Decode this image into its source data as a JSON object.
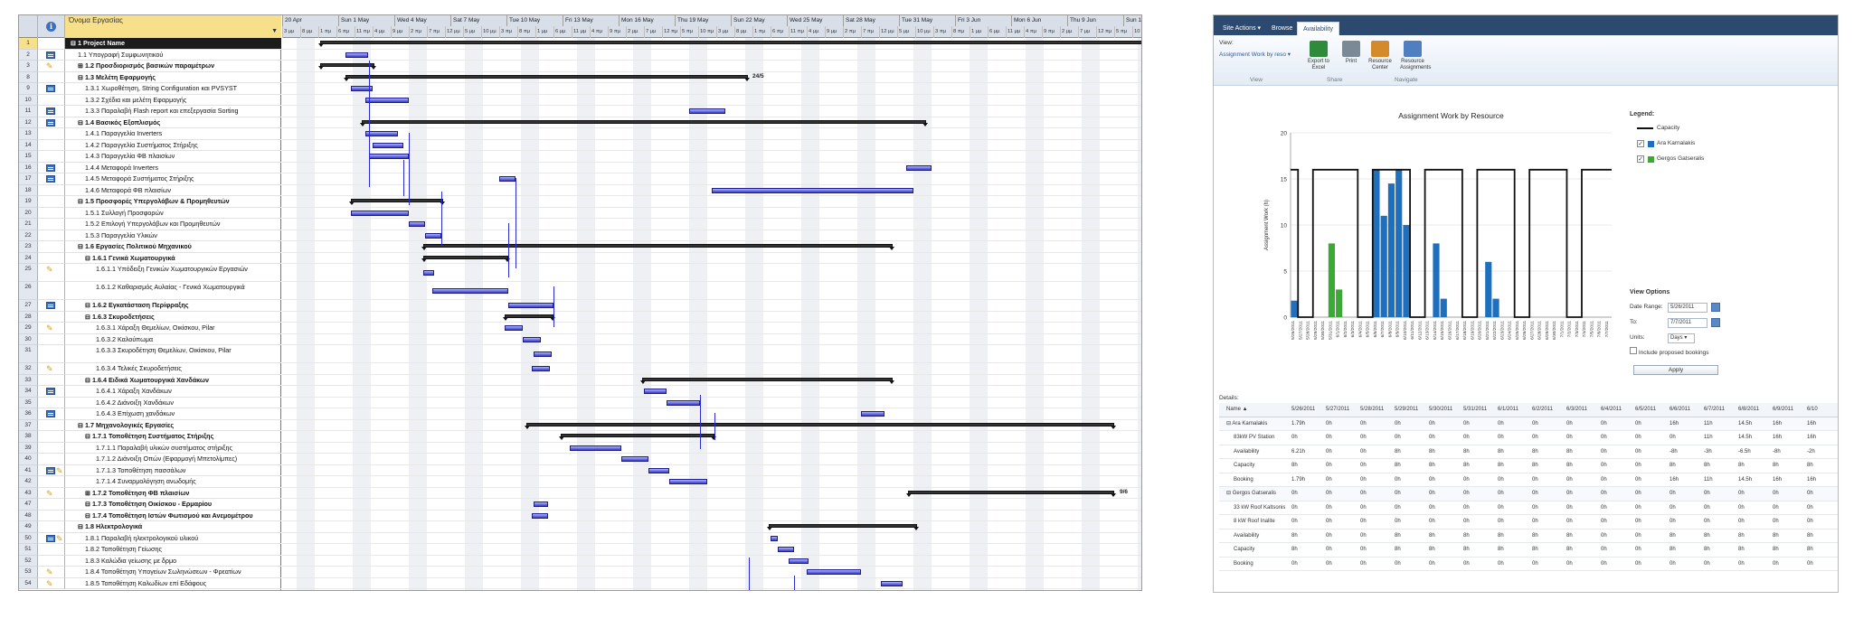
{
  "gantt": {
    "header": {
      "name_col": "Όνομα Εργασίας"
    },
    "weeks": [
      "20 Apr",
      "Sun 1 May",
      "Wed 4 May",
      "Sat 7 May",
      "Tue 10 May",
      "Fri 13 May",
      "Mon 16 May",
      "Thu 19 May",
      "Sun 22 May",
      "Wed 25 May",
      "Sat 28 May",
      "Tue 31 May",
      "Fri 3 Jun",
      "Mon 6 Jun",
      "Thu 9 Jun",
      "Sun 12"
    ],
    "periods": [
      "3 μμ",
      "8 μμ",
      "1 πμ",
      "6 πμ",
      "11 πμ",
      "4 μμ",
      "9 μμ",
      "2 πμ",
      "7 πμ",
      "12 μμ",
      "5 μμ",
      "10 μμ",
      "3 πμ",
      "8 πμ",
      "1 μμ",
      "6 μμ",
      "11 μμ",
      "4 πμ",
      "9 πμ",
      "2 μμ",
      "7 μμ",
      "12 πμ",
      "5 πμ",
      "10 πμ",
      "3 μμ",
      "8 μμ",
      "1 πμ",
      "6 πμ",
      "11 πμ",
      "4 μμ",
      "9 μμ",
      "2 πμ",
      "7 πμ",
      "12 μμ",
      "5 μμ",
      "10 μμ",
      "3 πμ",
      "8 πμ",
      "1 μμ",
      "6 μμ",
      "11 μμ",
      "4 πμ",
      "9 πμ",
      "2 μμ",
      "7 μμ",
      "12 πμ",
      "5 πμ",
      "10 πμ",
      "3 μμ",
      "8 μμ"
    ],
    "rows": [
      {
        "num": "1",
        "name": "1 Project Name",
        "level": 0,
        "type": "sel",
        "ind": ""
      },
      {
        "num": "2",
        "name": "1.1 Υπογραφή Συμφωνητικού",
        "level": 1,
        "type": "task",
        "ind": "note"
      },
      {
        "num": "3",
        "name": "1.2 Προσδιορισμός βασικών παραμέτρων",
        "level": 1,
        "type": "sum",
        "ind": "flag",
        "collapsed": true
      },
      {
        "num": "8",
        "name": "1.3 Μελέτη Εφαρμογής",
        "level": 1,
        "type": "sum",
        "ind": ""
      },
      {
        "num": "9",
        "name": "1.3.1 Χωροθέτηση, String Configuration και PVSYST",
        "level": 2,
        "type": "task",
        "ind": "note"
      },
      {
        "num": "10",
        "name": "1.3.2 Σχέδια και μελέτη Εφαρμογής",
        "level": 2,
        "type": "task",
        "ind": ""
      },
      {
        "num": "11",
        "name": "1.3.3 Παραλαβή Flash report και επεξεργασία Sorting",
        "level": 2,
        "type": "task",
        "ind": "note"
      },
      {
        "num": "12",
        "name": "1.4 Βασικός Εξοπλισμός",
        "level": 1,
        "type": "sum",
        "ind": "note"
      },
      {
        "num": "13",
        "name": "1.4.1 Παραγγελία Inverters",
        "level": 2,
        "type": "task",
        "ind": ""
      },
      {
        "num": "14",
        "name": "1.4.2 Παραγγελία Συστήματος Στήριξης",
        "level": 2,
        "type": "task",
        "ind": ""
      },
      {
        "num": "15",
        "name": "1.4.3 Παραγγελία ΦΒ πλαισίων",
        "level": 2,
        "type": "task",
        "ind": ""
      },
      {
        "num": "16",
        "name": "1.4.4 Μεταφορά Inverters",
        "level": 2,
        "type": "task",
        "ind": "note"
      },
      {
        "num": "17",
        "name": "1.4.5 Μεταφορά Συστήματος Στήριξης",
        "level": 2,
        "type": "task",
        "ind": "note"
      },
      {
        "num": "18",
        "name": "1.4.6 Μεταφορά ΦΒ πλαισίων",
        "level": 2,
        "type": "task",
        "ind": ""
      },
      {
        "num": "19",
        "name": "1.5 Προσφορές Υπεργολάβων & Προμηθευτών",
        "level": 1,
        "type": "sum",
        "ind": ""
      },
      {
        "num": "20",
        "name": "1.5.1 Συλλογή Προσφορών",
        "level": 2,
        "type": "task",
        "ind": ""
      },
      {
        "num": "21",
        "name": "1.5.2 Επιλογή Υπεργολάβων και Προμηθευτών",
        "level": 2,
        "type": "task",
        "ind": ""
      },
      {
        "num": "22",
        "name": "1.5.3 Παραγγελία Υλικών",
        "level": 2,
        "type": "task",
        "ind": ""
      },
      {
        "num": "23",
        "name": "1.6 Εργασίες Πολιτικού Μηχανικού",
        "level": 1,
        "type": "sum",
        "ind": ""
      },
      {
        "num": "24",
        "name": "1.6.1 Γενικά Χωματουργικά",
        "level": 2,
        "type": "sum",
        "ind": ""
      },
      {
        "num": "25",
        "name": "1.6.1.1 Υπόδειξη Γενικών Χωματουργικών Εργασιών",
        "level": 3,
        "type": "task",
        "ind": "flag",
        "tall": true
      },
      {
        "num": "26",
        "name": "1.6.1.2 Καθαρισμός Αυλαίας - Γενικά Χωματουργικά",
        "level": 3,
        "type": "task",
        "ind": "",
        "tall": true
      },
      {
        "num": "27",
        "name": "1.6.2 Εγκατάσταση Περίφραξης",
        "level": 2,
        "type": "sum",
        "ind": "note"
      },
      {
        "num": "28",
        "name": "1.6.3 Σκυροδετήσεις",
        "level": 2,
        "type": "sum",
        "ind": ""
      },
      {
        "num": "29",
        "name": "1.6.3.1 Χάραξη Θεμελίων, Οικίσκου, Pilar",
        "level": 3,
        "type": "task",
        "ind": "flag"
      },
      {
        "num": "30",
        "name": "1.6.3.2 Καλούπωμα",
        "level": 3,
        "type": "task",
        "ind": ""
      },
      {
        "num": "31",
        "name": "1.6.3.3 Σκυροδέτηση Θεμελίων, Οικίσκου, Pilar",
        "level": 3,
        "type": "task",
        "ind": "",
        "tall": true
      },
      {
        "num": "32",
        "name": "1.6.3.4 Τελικές Σκυροδετήσεις",
        "level": 3,
        "type": "task",
        "ind": "flag"
      },
      {
        "num": "33",
        "name": "1.6.4 Ειδικά Χωματουργικά Χανδάκων",
        "level": 2,
        "type": "sum",
        "ind": ""
      },
      {
        "num": "34",
        "name": "1.6.4.1 Χάραξη Χανδάκων",
        "level": 3,
        "type": "task",
        "ind": "note"
      },
      {
        "num": "35",
        "name": "1.6.4.2 Διάνοιξη Χανδάκων",
        "level": 3,
        "type": "task",
        "ind": ""
      },
      {
        "num": "36",
        "name": "1.6.4.3 Επίχωση χανδάκων",
        "level": 3,
        "type": "task",
        "ind": "note"
      },
      {
        "num": "37",
        "name": "1.7 Μηχανολογικές Εργασίες",
        "level": 1,
        "type": "sum",
        "ind": ""
      },
      {
        "num": "38",
        "name": "1.7.1 Τοποθέτηση Συστήματος Στήριξης",
        "level": 2,
        "type": "sum",
        "ind": ""
      },
      {
        "num": "39",
        "name": "1.7.1.1 Παραλαβή υλικών συστήματος στήριξης",
        "level": 3,
        "type": "task",
        "ind": ""
      },
      {
        "num": "40",
        "name": "1.7.1.2 Διάνοιξη Οπών (Εφαρμογή Μπετολίμπες)",
        "level": 3,
        "type": "task",
        "ind": ""
      },
      {
        "num": "41",
        "name": "1.7.1.3 Τοποθέτηση πασσάλων",
        "level": 3,
        "type": "task",
        "ind": "both"
      },
      {
        "num": "42",
        "name": "1.7.1.4 Συναρμολόγηση ανωδομής",
        "level": 3,
        "type": "task",
        "ind": ""
      },
      {
        "num": "43",
        "name": "1.7.2 Τοποθέτηση ΦΒ πλαισίων",
        "level": 2,
        "type": "sum",
        "ind": "flag",
        "collapsed": true
      },
      {
        "num": "47",
        "name": "1.7.3 Τοποθέτηση Οικίσκου - Ερμαρίου",
        "level": 2,
        "type": "sum",
        "ind": ""
      },
      {
        "num": "48",
        "name": "1.7.4 Τοποθέτηση Ιστών Φωτισμού και Ανεμομέτρου",
        "level": 2,
        "type": "sum",
        "ind": ""
      },
      {
        "num": "49",
        "name": "1.8 Ηλεκτρολογικά",
        "level": 1,
        "type": "sum",
        "ind": ""
      },
      {
        "num": "50",
        "name": "1.8.1 Παραλαβή ηλεκτρολογικού υλικού",
        "level": 2,
        "type": "task",
        "ind": "both"
      },
      {
        "num": "51",
        "name": "1.8.2 Τοποθέτηση Γείωσης",
        "level": 2,
        "type": "task",
        "ind": ""
      },
      {
        "num": "52",
        "name": "1.8.3 Καλώδια γείωσης με δρμο",
        "level": 2,
        "type": "task",
        "ind": ""
      },
      {
        "num": "53",
        "name": "1.8.4 Τοποθέτηση Υπογείων Σωληνώσεων - Φρεατίων",
        "level": 2,
        "type": "task",
        "ind": "flag"
      },
      {
        "num": "54",
        "name": "1.8.5 Τοποθέτηση Καλωδίων επί Εδάφους",
        "level": 2,
        "type": "task",
        "ind": "flag"
      }
    ],
    "bar_labels": {
      "r8": "24/5",
      "r43": "9/6"
    }
  },
  "pwa": {
    "tabs": [
      "Site Actions",
      "Browse",
      "Availability"
    ],
    "active_tab": "Availability",
    "ribbon": {
      "view_label": "View:",
      "view_select": "Assignment Work by reso ▾",
      "buttons": [
        {
          "label": "Export to Excel",
          "icon": "export-excel-icon",
          "color": "#2e8b3c"
        },
        {
          "label": "Print",
          "icon": "print-icon",
          "color": "#7b8896"
        },
        {
          "label": "Resource Center",
          "icon": "resource-center-icon",
          "color": "#d48a2a"
        },
        {
          "label": "Resource Assignments",
          "icon": "resource-assignments-icon",
          "color": "#4f7fc1"
        }
      ],
      "groups": [
        "View",
        "Share",
        "Navigate"
      ]
    },
    "legend": {
      "title": "Legend:",
      "items": [
        {
          "label": "Capacity",
          "type": "line",
          "color": "#111111"
        },
        {
          "label": "Ara Karnalakis",
          "type": "bar",
          "color": "#1f6fbf",
          "checked": true
        },
        {
          "label": "Gergos Gatseralis",
          "type": "bar",
          "color": "#3aaa35",
          "checked": true
        }
      ]
    },
    "view_options": {
      "title": "View Options",
      "date_range_label": "Date Range:",
      "date_from": "5/26/2011",
      "to_label": "To:",
      "date_to": "7/7/2011",
      "units_label": "Units:",
      "units_value": "Days",
      "proposed_label": "Include proposed bookings",
      "apply_label": "Apply"
    },
    "details": {
      "title": "Details:",
      "header_name": "Name ▲",
      "columns": [
        "5/26/2011",
        "5/27/2011",
        "5/28/2011",
        "5/29/2011",
        "5/30/2011",
        "5/31/2011",
        "6/1/2011",
        "6/2/2011",
        "6/3/2011",
        "6/4/2011",
        "6/5/2011",
        "6/6/2011",
        "6/7/2011",
        "6/8/2011",
        "6/9/2011",
        "6/10"
      ],
      "rows": [
        {
          "name": "⊟ Ara Karnalakis",
          "res": true,
          "values": [
            "1.79h",
            "0h",
            "0h",
            "0h",
            "0h",
            "0h",
            "0h",
            "0h",
            "0h",
            "0h",
            "0h",
            "16h",
            "11h",
            "14.5h",
            "16h",
            "16h"
          ]
        },
        {
          "name": "83kW PV Station",
          "values": [
            "0h",
            "0h",
            "0h",
            "0h",
            "0h",
            "0h",
            "0h",
            "0h",
            "0h",
            "0h",
            "0h",
            "0h",
            "11h",
            "14.5h",
            "16h",
            "16h"
          ]
        },
        {
          "name": "Availability",
          "values": [
            "6.21h",
            "0h",
            "0h",
            "8h",
            "8h",
            "8h",
            "8h",
            "8h",
            "8h",
            "0h",
            "0h",
            "-8h",
            "-3h",
            "-6.5h",
            "-8h",
            "-2h"
          ]
        },
        {
          "name": "Capacity",
          "values": [
            "8h",
            "0h",
            "0h",
            "8h",
            "8h",
            "8h",
            "8h",
            "8h",
            "8h",
            "0h",
            "0h",
            "8h",
            "8h",
            "8h",
            "8h",
            "8h"
          ]
        },
        {
          "name": "Booking",
          "values": [
            "1.79h",
            "0h",
            "0h",
            "0h",
            "0h",
            "0h",
            "0h",
            "0h",
            "0h",
            "0h",
            "0h",
            "16h",
            "11h",
            "14.5h",
            "16h",
            "16h"
          ]
        },
        {
          "name": "⊟ Gergos Gatseralis",
          "res": true,
          "values": [
            "0h",
            "0h",
            "0h",
            "0h",
            "0h",
            "0h",
            "0h",
            "0h",
            "0h",
            "0h",
            "0h",
            "0h",
            "0h",
            "0h",
            "0h",
            "0h"
          ]
        },
        {
          "name": "33 kW Roof Kaltsonis",
          "values": [
            "0h",
            "0h",
            "0h",
            "0h",
            "0h",
            "0h",
            "0h",
            "0h",
            "0h",
            "0h",
            "0h",
            "0h",
            "0h",
            "0h",
            "0h",
            "0h"
          ]
        },
        {
          "name": "8 kW Roof Inalite",
          "values": [
            "0h",
            "0h",
            "0h",
            "0h",
            "0h",
            "0h",
            "0h",
            "0h",
            "0h",
            "0h",
            "0h",
            "0h",
            "0h",
            "0h",
            "0h",
            "0h"
          ]
        },
        {
          "name": "Availability",
          "values": [
            "8h",
            "0h",
            "0h",
            "8h",
            "8h",
            "8h",
            "8h",
            "8h",
            "8h",
            "0h",
            "0h",
            "8h",
            "8h",
            "8h",
            "8h",
            "8h"
          ]
        },
        {
          "name": "Capacity",
          "values": [
            "8h",
            "0h",
            "0h",
            "8h",
            "8h",
            "8h",
            "8h",
            "8h",
            "8h",
            "0h",
            "0h",
            "8h",
            "8h",
            "8h",
            "8h",
            "8h"
          ]
        },
        {
          "name": "Booking",
          "values": [
            "0h",
            "0h",
            "0h",
            "0h",
            "0h",
            "0h",
            "0h",
            "0h",
            "0h",
            "0h",
            "0h",
            "0h",
            "0h",
            "0h",
            "0h",
            "0h"
          ]
        }
      ]
    }
  },
  "chart_data": {
    "type": "bar",
    "title": "Assignment Work by Resource",
    "ylabel": "Assignment Work (h)",
    "ylim": [
      0,
      20
    ],
    "yticks": [
      0,
      5,
      10,
      15,
      20
    ],
    "legend_position": "right",
    "categories": [
      "5/26/2011",
      "5/27/2011",
      "5/28/2011",
      "5/29/2011",
      "5/30/2011",
      "5/31/2011",
      "6/1/2011",
      "6/2/2011",
      "6/3/2011",
      "6/4/2011",
      "6/5/2011",
      "6/6/2011",
      "6/7/2011",
      "6/8/2011",
      "6/9/2011",
      "6/10/2011",
      "6/11/2011",
      "6/12/2011",
      "6/13/2011",
      "6/14/2011",
      "6/15/2011",
      "6/16/2011",
      "6/17/2011",
      "6/18/2011",
      "6/19/2011",
      "6/20/2011",
      "6/21/2011",
      "6/22/2011",
      "6/23/2011",
      "6/24/2011",
      "6/25/2011",
      "6/26/2011",
      "6/27/2011",
      "6/28/2011",
      "6/29/2011",
      "6/30/2011",
      "7/1/2011",
      "7/2/2011",
      "7/3/2011",
      "7/4/2011",
      "7/5/2011",
      "7/6/2011",
      "7/7/2011"
    ],
    "series": [
      {
        "name": "Capacity",
        "kind": "line",
        "color": "#111111",
        "values": [
          16,
          0,
          0,
          16,
          16,
          16,
          16,
          16,
          16,
          0,
          0,
          16,
          16,
          16,
          16,
          16,
          0,
          0,
          16,
          16,
          16,
          16,
          16,
          0,
          0,
          16,
          16,
          16,
          16,
          16,
          0,
          0,
          16,
          16,
          16,
          16,
          16,
          0,
          0,
          16,
          16,
          16,
          16
        ]
      },
      {
        "name": "Ara Karnalakis",
        "kind": "bar",
        "color": "#1f6fbf",
        "values": [
          1.79,
          0,
          0,
          0,
          0,
          0,
          0,
          0,
          0,
          0,
          0,
          16,
          11,
          14.5,
          16,
          10,
          0,
          0,
          0,
          8,
          2,
          0,
          0,
          0,
          0,
          0,
          6,
          2,
          0,
          0,
          0,
          0,
          0,
          0,
          0,
          0,
          0,
          0,
          0,
          0,
          0,
          0,
          0
        ]
      },
      {
        "name": "Gergos Gatseralis",
        "kind": "bar",
        "color": "#3aaa35",
        "values": [
          0,
          0,
          0,
          0,
          0,
          8,
          3,
          0,
          0,
          0,
          0,
          0,
          0,
          0,
          0,
          0,
          0,
          0,
          0,
          0,
          0,
          0,
          0,
          0,
          0,
          0,
          0,
          0,
          0,
          0,
          0,
          0,
          0,
          0,
          0,
          0,
          0,
          0,
          0,
          0,
          0,
          0,
          0
        ]
      }
    ]
  }
}
